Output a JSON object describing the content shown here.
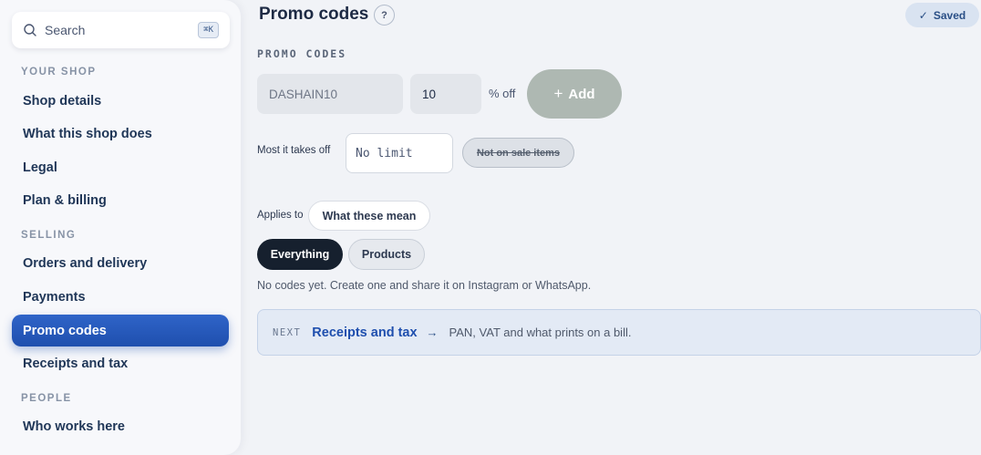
{
  "sidebar": {
    "search": {
      "label": "Search",
      "shortcut": "⌘K"
    },
    "sections": [
      {
        "label": "YOUR SHOP",
        "items": [
          "Shop details",
          "What this shop does",
          "Legal",
          "Plan & billing"
        ]
      },
      {
        "label": "SELLING",
        "items": [
          "Orders and delivery",
          "Payments",
          "Promo codes",
          "Receipts and tax"
        ]
      },
      {
        "label": "PEOPLE",
        "items": [
          "Who works here"
        ]
      }
    ],
    "active_item": "Promo codes"
  },
  "header": {
    "title": "Promo codes",
    "help": "?",
    "saved": "Saved"
  },
  "promo": {
    "heading": "PROMO CODES",
    "code_placeholder": "DASHAIN10",
    "percent_value": "10",
    "percent_suffix": "% off",
    "add_label": "Add",
    "cap_label": "Most it takes off",
    "cap_placeholder": "No limit",
    "sale_chip": "Not on sale items",
    "applies_label": "Applies to",
    "meaning_chip": "What these mean",
    "scope_options": [
      "Everything",
      "Products"
    ],
    "scope_selected": "Everything",
    "empty_note": "No codes yet. Create one and share it on Instagram or WhatsApp."
  },
  "next": {
    "tag": "NEXT",
    "title": "Receipts and tax",
    "arrow": "→",
    "description": "PAN, VAT and what prints on a bill."
  },
  "colors": {
    "accent": "#1f4fae",
    "add_button": "#aeb8b2",
    "selected_segment": "#16202e"
  }
}
